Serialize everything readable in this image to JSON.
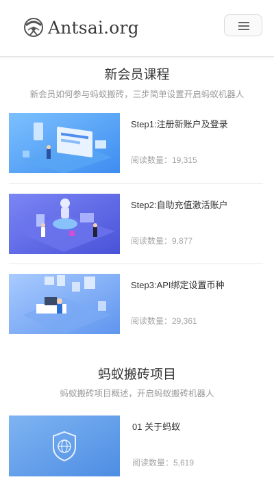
{
  "header": {
    "logo_text": "Antsai.org",
    "menu_icon": "hamburger-menu-icon"
  },
  "course_section": {
    "title": "新会员课程",
    "subtitle": "新会员如何参与蚂蚁搬砖，三步简单设置开启蚂蚁机器人",
    "items": [
      {
        "title": "Step1:注册新账户及登录",
        "reads": "阅读数量：19,315",
        "image": "dashboard-illustration"
      },
      {
        "title": "Step2:自助充值激活账户",
        "reads": "阅读数量：9,877",
        "image": "robot-illustration"
      },
      {
        "title": "Step3:API绑定设置币种",
        "reads": "阅读数量：29,361",
        "image": "desk-illustration"
      }
    ]
  },
  "project_section": {
    "title": "蚂蚁搬砖项目",
    "subtitle": "蚂蚁搬砖项目概述，开启蚂蚁搬砖机器人",
    "items": [
      {
        "title": "01 关于蚂蚁",
        "reads": "阅读数量：5,619",
        "image": "shield-globe-illustration"
      }
    ]
  },
  "colors": {
    "thumb_blue": "#4f8ff0",
    "thumb_purple": "#5a63e6",
    "thumb_light": "#6aa6f2",
    "text_main": "#333333",
    "text_muted": "#a3a3a3"
  }
}
